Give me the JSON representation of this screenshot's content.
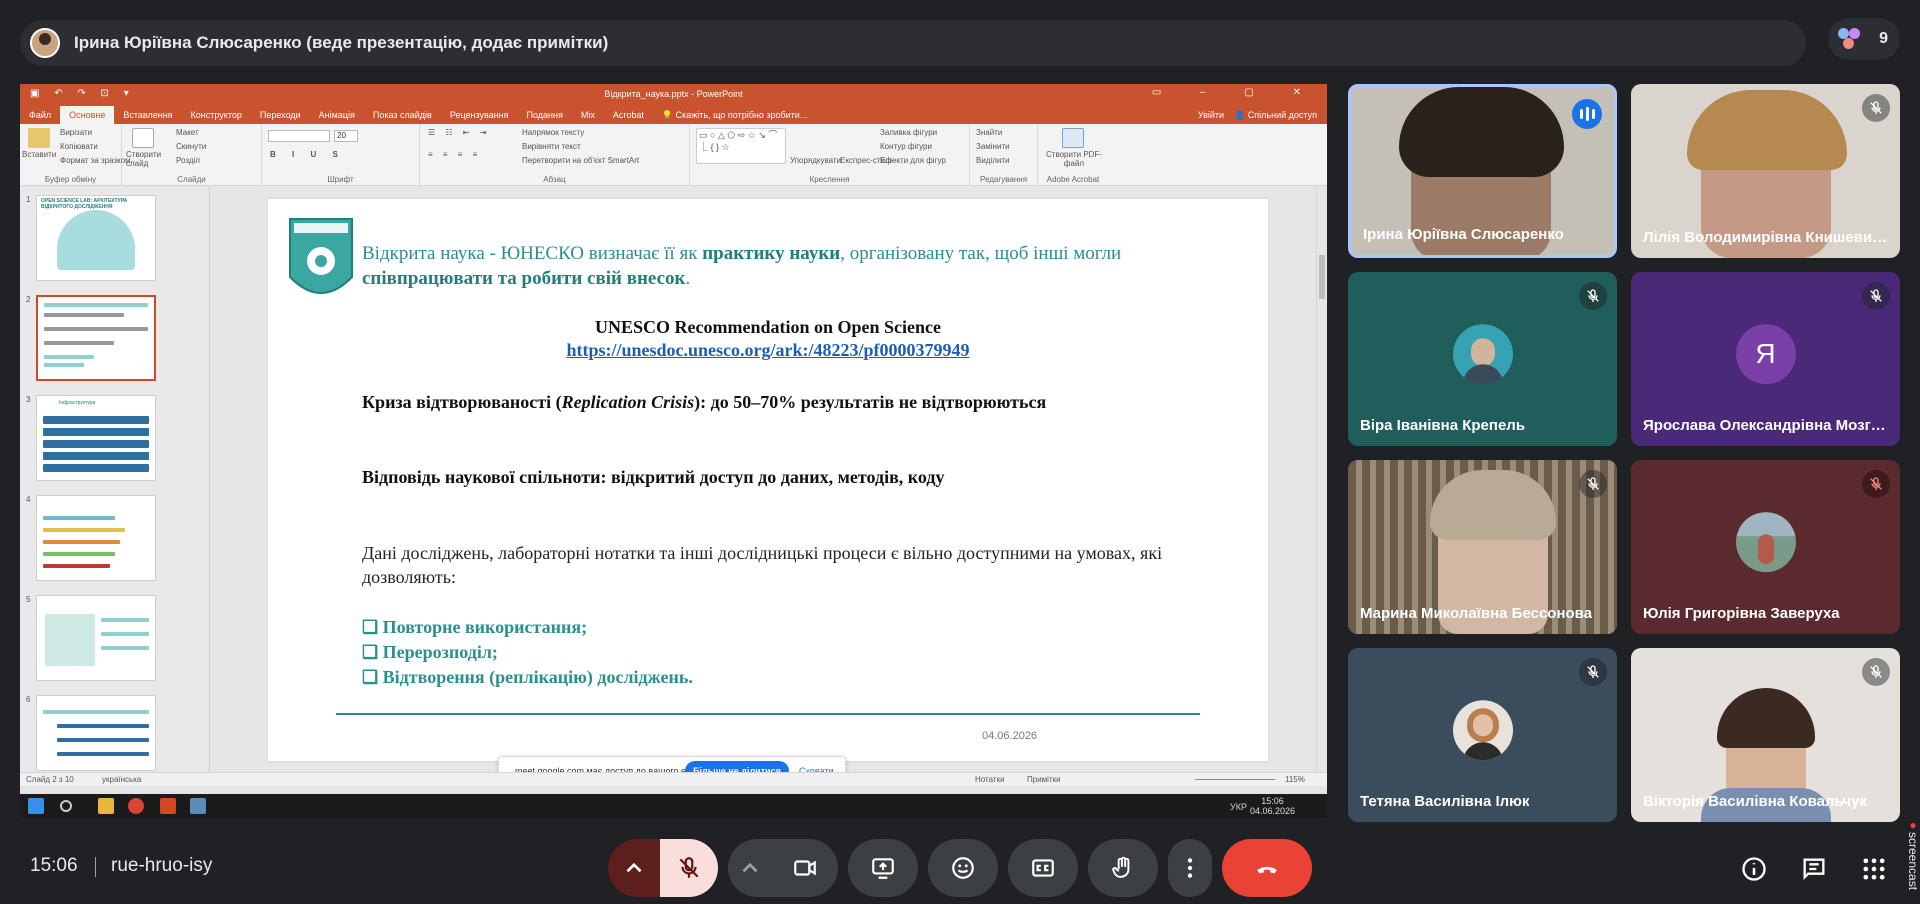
{
  "presenter_bar": {
    "title": "Ірина Юріївна Слюсаренко (веде презентацію, додає примітки)",
    "participant_count": "9"
  },
  "powerpoint": {
    "window_title": "Відкрита_наука.pptx - PowerPoint",
    "tabs": [
      "Файл",
      "Основне",
      "Вставлення",
      "Конструктор",
      "Переходи",
      "Анімація",
      "Показ слайдів",
      "Рецензування",
      "Подання",
      "Mix",
      "Acrobat"
    ],
    "active_tab": "Основне",
    "tell_me": "Скажіть, що потрібно зробити...",
    "sign_in": "Увійти",
    "share": "Спільний доступ",
    "ribbon": {
      "clipboard": {
        "paste": "Вставити",
        "cut": "Вирізати",
        "copy": "Копіювати",
        "format_painter": "Формат за зразком",
        "group": "Буфер обміну"
      },
      "slides": {
        "new_slide": "Створити слайд",
        "layout": "Макет",
        "reset": "Скинути",
        "section": "Розділ",
        "group": "Слайди"
      },
      "font": {
        "group": "Шрифт",
        "size": "20"
      },
      "paragraph": {
        "direction": "Напрямок тексту",
        "align": "Вирівняти текст",
        "smartart": "Перетворити на об'єкт SmartArt",
        "group": "Абзац"
      },
      "drawing": {
        "arrange": "Упорядкувати",
        "quick_styles": "Експрес-стилі",
        "fill": "Заливка фігури",
        "outline": "Контур фігури",
        "effects": "Ефекти для фігур",
        "group": "Креслення"
      },
      "editing": {
        "find": "Знайти",
        "replace": "Замінити",
        "select": "Виділити",
        "group": "Редагування"
      },
      "acrobat": {
        "create_pdf": "Створити PDF-файл",
        "group": "Adobe Acrobat"
      }
    },
    "thumbnails": [
      {
        "num": "1",
        "caption": "OPEN SCIENCE LAB: АРХІТЕКТУРА ВІДКРИТОГО ДОСЛІДЖЕННЯ"
      },
      {
        "num": "2",
        "caption": ""
      },
      {
        "num": "3",
        "caption": "Інфраструктура"
      },
      {
        "num": "4",
        "caption": ""
      },
      {
        "num": "5",
        "caption": ""
      },
      {
        "num": "6",
        "caption": ""
      }
    ],
    "slide": {
      "intro_plain_1": "Відкрита наука - ЮНЕСКО визначає її як ",
      "intro_bold_1": "практику науки",
      "intro_plain_2": ", організовану так, щоб інші могли ",
      "intro_bold_2": "співпрацювати та робити свій внесок",
      "intro_end": ".",
      "ref_title": "UNESCO Recommendation on Open Science",
      "ref_url": "https://unesdoc.unesco.org/ark:/48223/pf0000379949",
      "crisis_pre": "Криза відтворюваності (",
      "crisis_italic": "Replication Crisis",
      "crisis_post": "): до 50–70% результатів не відтворюються",
      "answer": "Відповідь наукової спільноти: відкритий доступ до даних, методів, коду",
      "data_text": "Дані досліджень, лабораторні нотатки та інші дослідницькі процеси є вільно доступними на умовах, які дозволяють:",
      "bullets": [
        "❑ Повторне використання;",
        "❑ Перерозподіл;",
        "❑ Відтворення (реплікацію) досліджень."
      ],
      "date": "04.06.2026"
    },
    "share_notice": {
      "text": "meet.google.com має доступ до вашого екрана.",
      "stop_button": "Більше не ділитися",
      "hide_link": "Сховати"
    },
    "status": {
      "slide_of": "Слайд 2 з 10",
      "language": "українська",
      "notes": "Нотатки",
      "comments": "Примітки",
      "zoom": "115%"
    },
    "taskbar": {
      "lang": "УКР",
      "time": "15:06",
      "date": "04.06.2026"
    }
  },
  "participants": [
    {
      "name": "Ірина Юріївна Слюсаренко",
      "speaking": true
    },
    {
      "name": "Лілія Володимирівна Книшевицька",
      "muted": true
    },
    {
      "name": "Віра Іванівна Крепель",
      "muted": true
    },
    {
      "name": "Ярослава Олександрівна Мозгова",
      "muted": true,
      "letter": "Я"
    },
    {
      "name": "Марина Миколаївна Бессонова",
      "muted": true
    },
    {
      "name": "Юлія Григорівна Заверуха",
      "muted": true
    },
    {
      "name": "Тетяна Василівна Ілюк",
      "muted": true
    },
    {
      "name": "Вікторія Василівна Ковальчук",
      "muted": true
    }
  ],
  "bottom_bar": {
    "time": "15:06",
    "meeting_code": "rue-hruo-isy",
    "screencast_label": "screencast"
  },
  "colors": {
    "ppt_accent": "#c9532e",
    "slide_teal": "#2b8f8a",
    "meet_bg": "#202124",
    "end_call_red": "#ea4335",
    "mic_muted_bg": "#f9dedc"
  }
}
